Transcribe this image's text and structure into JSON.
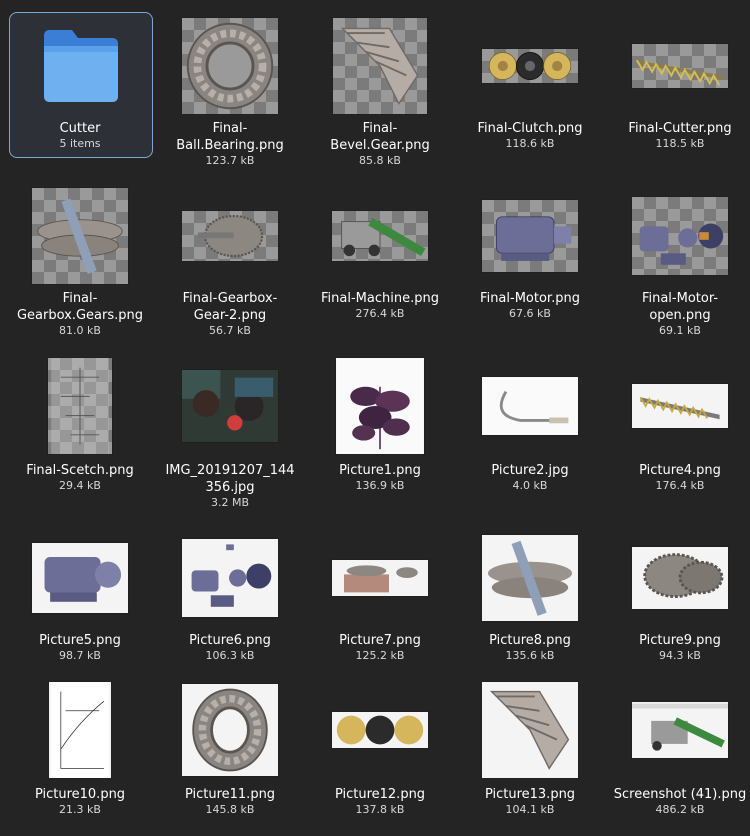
{
  "folder": {
    "name": "Cutter",
    "count": "5 items"
  },
  "files": [
    {
      "l1": "Final-",
      "l2": "Ball.Bearing.png",
      "size": "123.7 kB"
    },
    {
      "l1": "Final-",
      "l2": "Bevel.Gear.png",
      "size": "85.8 kB"
    },
    {
      "l1": "Final-Clutch.png",
      "l2": "",
      "size": "118.6 kB"
    },
    {
      "l1": "Final-Cutter.png",
      "l2": "",
      "size": "118.5 kB"
    },
    {
      "l1": "Final-",
      "l2": "Gearbox.Gears.png",
      "size": "81.0 kB"
    },
    {
      "l1": "Final-Gearbox-",
      "l2": "Gear-2.png",
      "size": "56.7 kB"
    },
    {
      "l1": "Final-Machine.png",
      "l2": "",
      "size": "276.4 kB"
    },
    {
      "l1": "Final-Motor.png",
      "l2": "",
      "size": "67.6 kB"
    },
    {
      "l1": "Final-Motor-",
      "l2": "open.png",
      "size": "69.1 kB"
    },
    {
      "l1": "Final-Scetch.png",
      "l2": "",
      "size": "29.4 kB"
    },
    {
      "l1": "IMG_20191207_144",
      "l2": "356.jpg",
      "size": "3.2 MB"
    },
    {
      "l1": "Picture1.png",
      "l2": "",
      "size": "136.9 kB"
    },
    {
      "l1": "Picture2.jpg",
      "l2": "",
      "size": "4.0 kB"
    },
    {
      "l1": "Picture4.png",
      "l2": "",
      "size": "176.4 kB"
    },
    {
      "l1": "Picture5.png",
      "l2": "",
      "size": "98.7 kB"
    },
    {
      "l1": "Picture6.png",
      "l2": "",
      "size": "106.3 kB"
    },
    {
      "l1": "Picture7.png",
      "l2": "",
      "size": "125.2 kB"
    },
    {
      "l1": "Picture8.png",
      "l2": "",
      "size": "135.6 kB"
    },
    {
      "l1": "Picture9.png",
      "l2": "",
      "size": "94.3 kB"
    },
    {
      "l1": "Picture10.png",
      "l2": "",
      "size": "21.3 kB"
    },
    {
      "l1": "Picture11.png",
      "l2": "",
      "size": "145.8 kB"
    },
    {
      "l1": "Picture12.png",
      "l2": "",
      "size": "137.8 kB"
    },
    {
      "l1": "Picture13.png",
      "l2": "",
      "size": "104.1 kB"
    },
    {
      "l1": "Screenshot (41).png",
      "l2": "",
      "size": "486.2 kB"
    }
  ],
  "colors": {
    "background": "#242424",
    "selection_border": "#7aa9d6",
    "folder": "#4a90e2"
  }
}
